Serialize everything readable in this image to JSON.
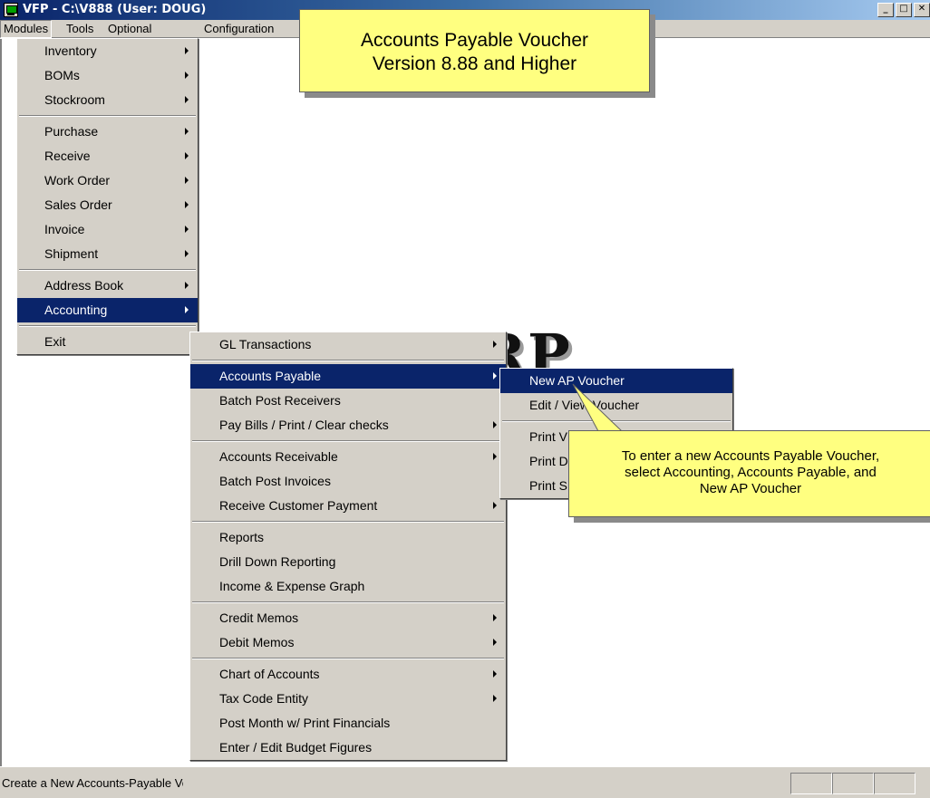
{
  "window": {
    "title": "VFP - C:\\V888  (User: DOUG)",
    "controls": [
      "_",
      "□",
      "✕"
    ]
  },
  "menubar": {
    "items": [
      "Modules",
      "Tools",
      "Optional",
      "Configuration"
    ]
  },
  "modules_menu": {
    "inventory": "Inventory",
    "boms": "BOMs",
    "stockroom": "Stockroom",
    "purchase": "Purchase",
    "receive": "Receive",
    "work_order": "Work Order",
    "sales_order": "Sales Order",
    "invoice": "Invoice",
    "shipment": "Shipment",
    "address_book": "Address Book",
    "accounting": "Accounting",
    "exit": "Exit"
  },
  "accounting_menu": {
    "gl_transactions": "GL Transactions",
    "accounts_payable": "Accounts Payable",
    "batch_post_receivers": "Batch Post Receivers",
    "pay_bills": "Pay Bills / Print / Clear checks",
    "accounts_receivable": "Accounts Receivable",
    "batch_post_invoices": "Batch Post Invoices",
    "receive_customer_payment": "Receive Customer Payment",
    "reports": "Reports",
    "drill_down": "Drill Down Reporting",
    "income_expense_graph": "Income & Expense Graph",
    "credit_memos": "Credit Memos",
    "debit_memos": "Debit Memos",
    "chart_of_accounts": "Chart of Accounts",
    "tax_code_entity": "Tax Code Entity",
    "post_month": "Post Month w/ Print Financials",
    "budget_figures": "Enter / Edit Budget Figures"
  },
  "ap_menu": {
    "new_voucher": "New AP Voucher",
    "edit_voucher": "Edit / View Voucher",
    "print_1": "Print V",
    "print_2": "Print D",
    "print_3": "Print S"
  },
  "logo_text": "MRP",
  "callouts": {
    "title_line1": "Accounts Payable Voucher",
    "title_line2": "Version 8.88 and Higher",
    "tip_line1": "To enter a new Accounts Payable Voucher,",
    "tip_line2": "select Accounting, Accounts Payable, and",
    "tip_line3": "New AP Voucher"
  },
  "statusbar": {
    "text": "Create a New Accounts-Payable Voucher"
  },
  "colors": {
    "menu_bg": "#d4d0c8",
    "highlight": "#0a246a",
    "callout_bg": "#ffff80",
    "title_gradient_start": "#0a246a"
  }
}
